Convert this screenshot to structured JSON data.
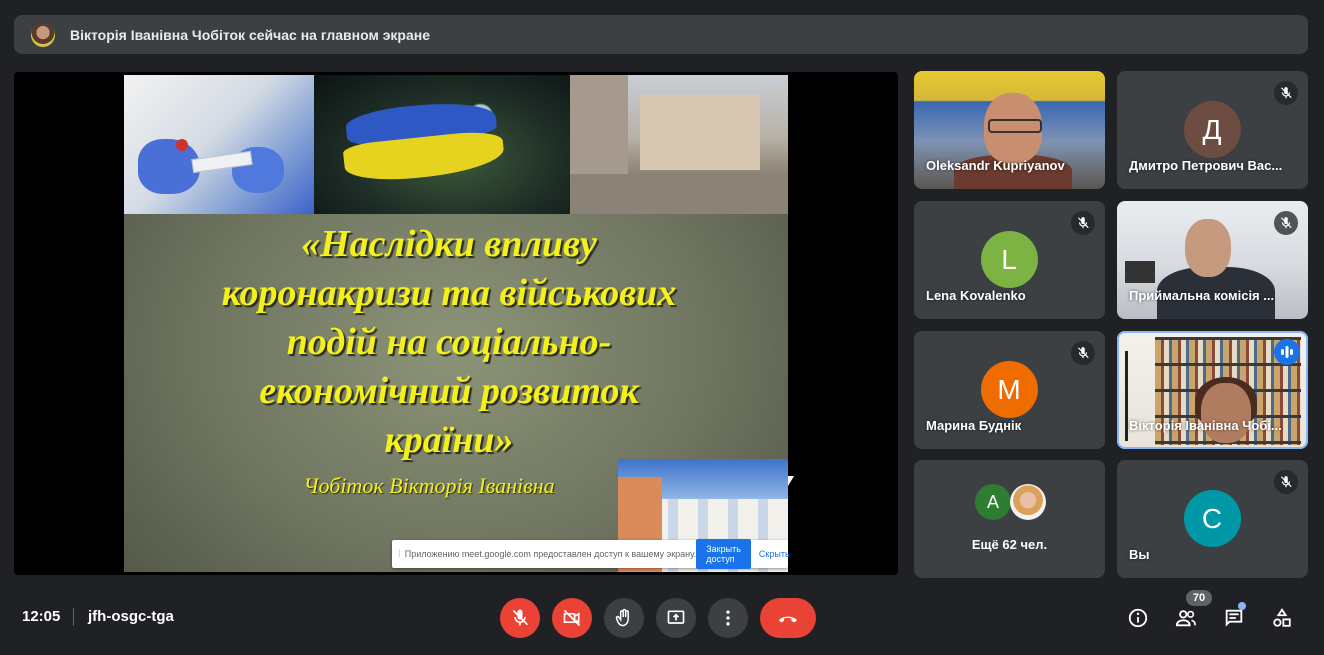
{
  "banner": {
    "text": "Вікторія Іванівна Чобіток сейчас на главном экране"
  },
  "slide": {
    "title_lines": [
      "«Наслідки впливу",
      "коронакризи та військових",
      "подій на соціально-",
      "економічний розвиток",
      "країни»"
    ],
    "author": "Чобіток Вікторія Іванівна"
  },
  "share_notice": {
    "message": "Приложению meet.google.com предоставлен доступ к вашему экрану.",
    "stop_label": "Закрыть доступ",
    "hide_label": "Скрыть"
  },
  "participants": [
    {
      "name": "Oleksandr Kupriyanov",
      "muted": false
    },
    {
      "name": "Дмитро Петрович Вас...",
      "initial": "Д",
      "avatar_color": "#6d4c41",
      "muted": true
    },
    {
      "name": "Lena Kovalenko",
      "initial": "L",
      "avatar_color": "#7cb342",
      "muted": true
    },
    {
      "name": "Приймальна комісія ...",
      "muted": true
    },
    {
      "name": "Марина Буднік",
      "initial": "М",
      "avatar_color": "#ef6c00",
      "muted": true
    },
    {
      "name": "Вікторія Іванівна Чобі...",
      "speaking": true
    },
    {
      "more_label": "Ещё 62 чел.",
      "initial": "А",
      "avatar_color": "#2e7d32"
    },
    {
      "name": "Вы",
      "initial": "С",
      "avatar_color": "#0097a7",
      "muted": true
    }
  ],
  "bottom_bar": {
    "time": "12:05",
    "meeting_code": "jfh-osgc-tga",
    "participants_count": "70",
    "icons": [
      "mic-off-icon",
      "camera-off-icon",
      "raise-hand-icon",
      "present-icon",
      "more-options-icon",
      "hang-up-icon",
      "info-icon",
      "people-icon",
      "chat-icon",
      "activities-icon"
    ]
  },
  "colors": {
    "background": "#202124",
    "tile": "#3c4043",
    "danger": "#ea4335",
    "accent": "#1a73e8"
  }
}
